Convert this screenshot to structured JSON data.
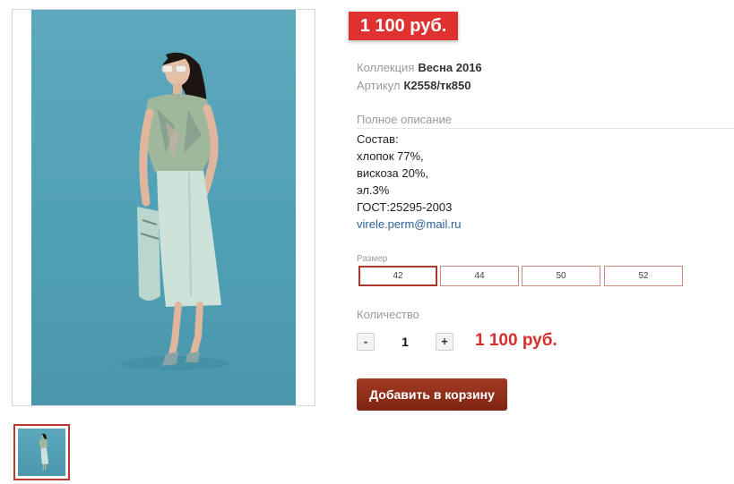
{
  "product": {
    "price_badge": "1 100 руб.",
    "collection_label": "Коллекция",
    "collection_value": "Весна 2016",
    "article_label": "Артикул",
    "article_value": "К2558/тк850"
  },
  "description": {
    "title": "Полное описание",
    "lines": [
      "Состав:",
      "хлопок 77%,",
      "вискоза 20%,",
      "эл.3%",
      "ГОСТ:25295-2003"
    ],
    "email": "virele.perm@mail.ru"
  },
  "sizes": {
    "label": "Размер",
    "options": [
      "42",
      "44",
      "50",
      "52"
    ],
    "selected": "42"
  },
  "quantity": {
    "label": "Количество",
    "minus": "-",
    "plus": "+",
    "value": "1",
    "total": "1 100 руб."
  },
  "cart": {
    "add_label": "Добавить в корзину"
  },
  "colors": {
    "accent_red": "#e03131",
    "button_brown": "#8b2a18",
    "photo_background": "#56a4b9"
  }
}
